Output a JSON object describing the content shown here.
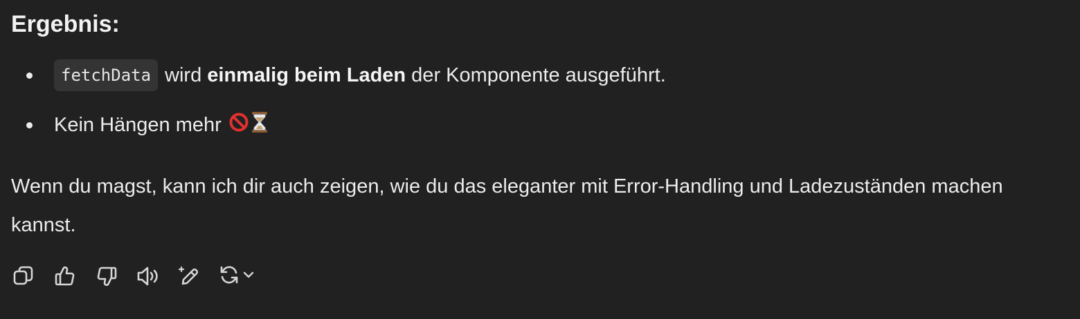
{
  "message": {
    "heading": "Ergebnis:",
    "bullets": [
      {
        "code": "fetchData",
        "text_before": "wird ",
        "strong": "einmalig beim Laden",
        "text_after": " der Komponente ausgeführt."
      },
      {
        "text": "Kein Hängen mehr",
        "emojis": [
          "no-entry-sign-emoji",
          "hourglass-emoji"
        ]
      }
    ],
    "paragraph": "Wenn du magst, kann ich dir auch zeigen, wie du das eleganter mit Error-Handling und Ladezuständen machen kannst."
  },
  "actions": [
    {
      "name": "copy-icon"
    },
    {
      "name": "thumbs-up-icon"
    },
    {
      "name": "thumbs-down-icon"
    },
    {
      "name": "speaker-icon"
    },
    {
      "name": "edit-sparkle-icon"
    },
    {
      "name": "regenerate-icon"
    },
    {
      "name": "chevron-down-icon"
    }
  ],
  "colors": {
    "background": "#212121",
    "text": "#ececec",
    "code_background": "#343434",
    "icon": "#d6d6d6",
    "emoji_red": "#e0312f",
    "emoji_hourglass": "#c8a26b"
  }
}
